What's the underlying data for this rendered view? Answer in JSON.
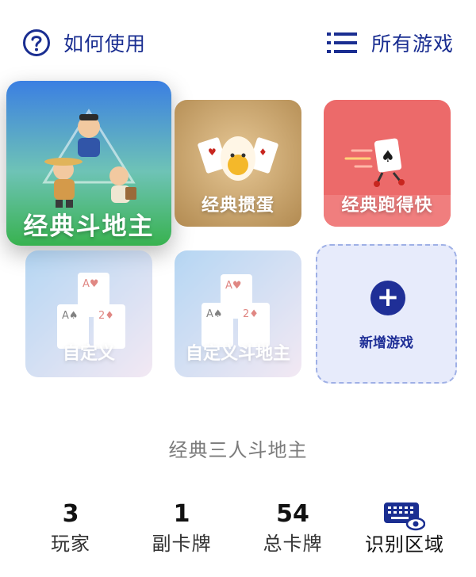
{
  "header": {
    "help_label": "如何使用",
    "all_games_label": "所有游戏"
  },
  "games": [
    {
      "id": "doudizhu",
      "title": "经典斗地主",
      "selected": true
    },
    {
      "id": "guandan",
      "title": "经典掼蛋"
    },
    {
      "id": "paodekuai",
      "title": "经典跑得快"
    },
    {
      "id": "custom1",
      "title": "自定义",
      "dimmed": true
    },
    {
      "id": "custom2",
      "title": "自定义斗地主",
      "dimmed": true
    }
  ],
  "add_game": {
    "label": "新增游戏"
  },
  "current_mode": "经典三人斗地主",
  "stats": {
    "players": {
      "value": "3",
      "label": "玩家"
    },
    "decks": {
      "value": "1",
      "label": "副卡牌"
    },
    "total_cards": {
      "value": "54",
      "label": "总卡牌"
    }
  },
  "recognition": {
    "label": "识别区域",
    "icon": "keyboard-eye-icon"
  },
  "colors": {
    "primary": "#1a2e91",
    "doudizhu_top": "#3f7fe0",
    "doudizhu_bottom": "#3db45a",
    "guandan_bg": "#c9a874",
    "paodekuai_bg": "#ef6c6c",
    "add_card_bg": "#e7ebfb"
  }
}
